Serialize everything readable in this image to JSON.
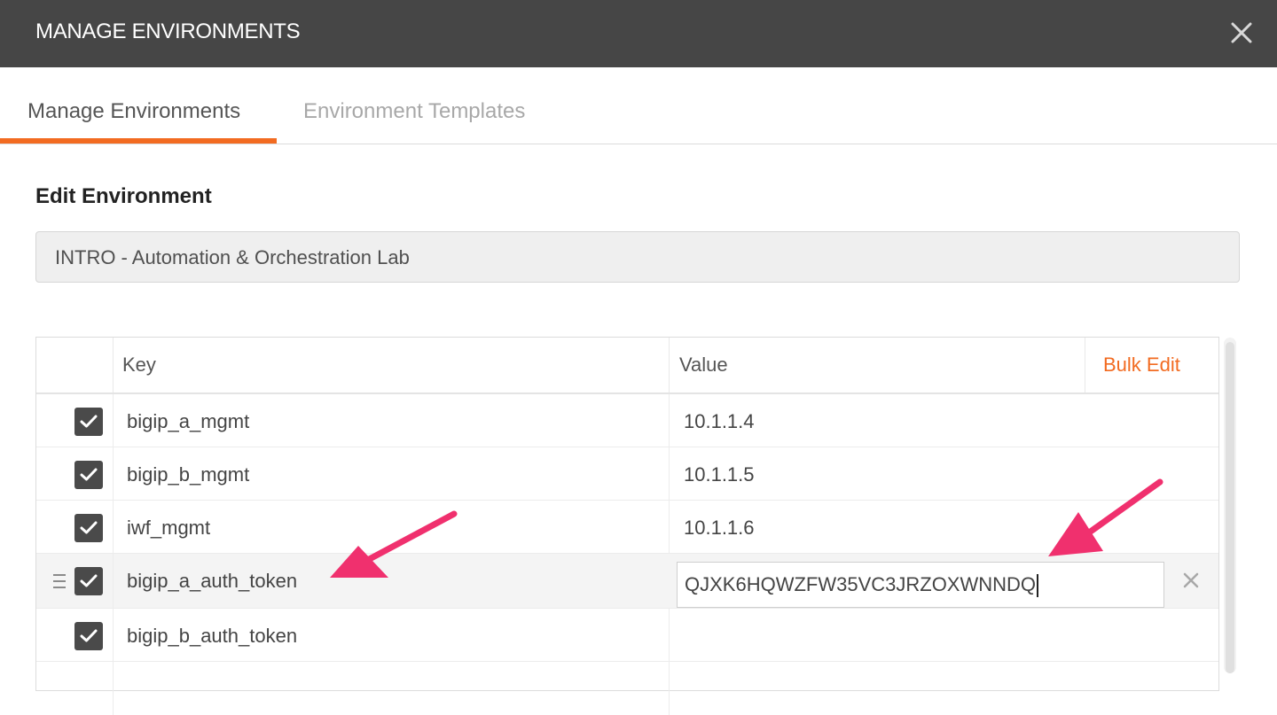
{
  "dialog": {
    "title": "MANAGE ENVIRONMENTS"
  },
  "tabs": [
    {
      "label": "Manage Environments",
      "active": true
    },
    {
      "label": "Environment Templates",
      "active": false
    }
  ],
  "edit": {
    "heading": "Edit Environment",
    "environment_name": "INTRO - Automation & Orchestration Lab"
  },
  "table": {
    "key_header": "Key",
    "value_header": "Value",
    "bulk_edit_label": "Bulk Edit",
    "rows": [
      {
        "key": "bigip_a_mgmt",
        "value": "10.1.1.4",
        "enabled": true
      },
      {
        "key": "bigip_b_mgmt",
        "value": "10.1.1.5",
        "enabled": true
      },
      {
        "key": "iwf_mgmt",
        "value": "10.1.1.6",
        "enabled": true
      },
      {
        "key": "bigip_a_auth_token",
        "value": "QJXK6HQWZFW35VC3JRZOXWNNDQ",
        "enabled": true
      },
      {
        "key": "bigip_b_auth_token",
        "value": "",
        "enabled": true
      }
    ]
  },
  "colors": {
    "titlebar": "#464646",
    "accent": "#f26b21",
    "annotation_arrow": "#f0306e"
  },
  "icons": {
    "close": "close-icon",
    "check": "check-icon",
    "drag": "drag-handle-icon",
    "delete": "delete-row-icon"
  }
}
